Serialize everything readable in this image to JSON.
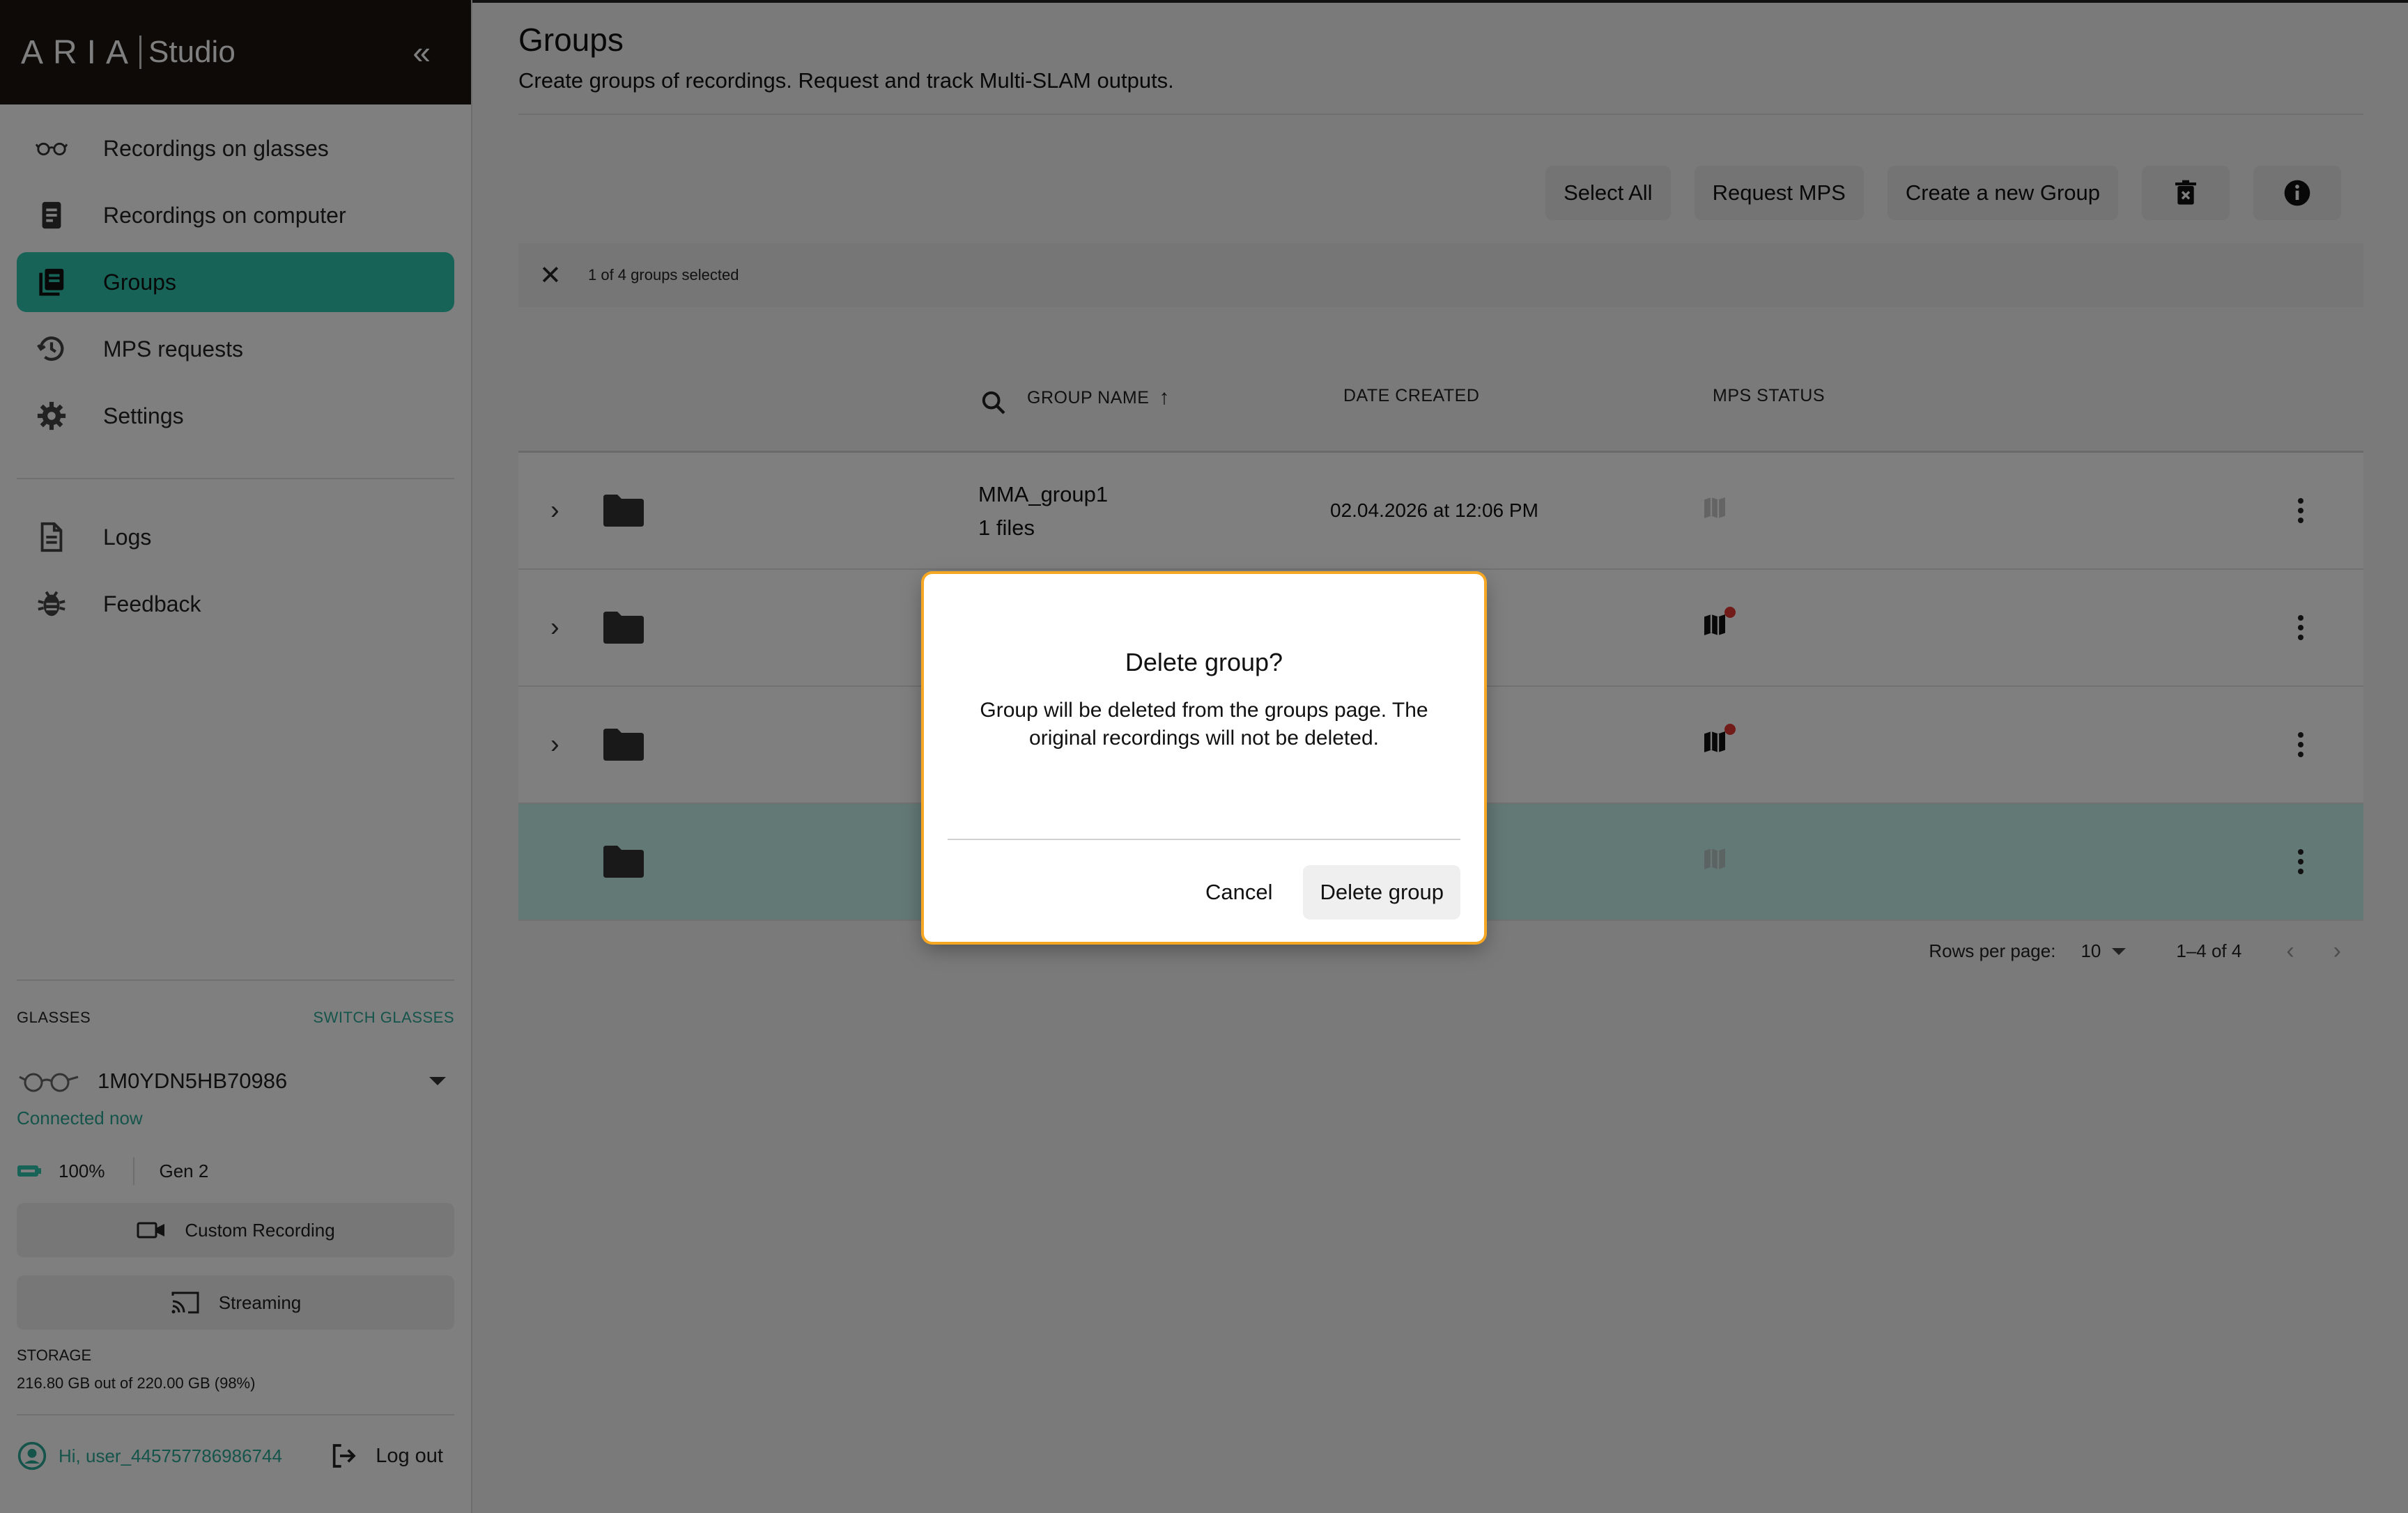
{
  "app": {
    "brand_word": "ARIA",
    "brand_product": "Studio"
  },
  "sidebar": {
    "items": [
      {
        "label": "Recordings on glasses",
        "icon": "glasses-icon"
      },
      {
        "label": "Recordings on computer",
        "icon": "document-icon"
      },
      {
        "label": "Groups",
        "icon": "groups-icon",
        "active": true
      },
      {
        "label": "MPS requests",
        "icon": "history-icon"
      },
      {
        "label": "Settings",
        "icon": "gear-icon"
      }
    ],
    "secondary_items": [
      {
        "label": "Logs",
        "icon": "logs-icon"
      },
      {
        "label": "Feedback",
        "icon": "bug-icon"
      }
    ],
    "glasses": {
      "section_label": "GLASSES",
      "switch_label": "SWITCH GLASSES",
      "device_id": "1M0YDN5HB70986",
      "connection": "Connected now",
      "battery": "100%",
      "generation": "Gen 2",
      "custom_recording_label": "Custom Recording",
      "streaming_label": "Streaming",
      "storage_label": "STORAGE",
      "storage_value": "216.80 GB out of 220.00 GB (98%)"
    },
    "user": {
      "greeting": "Hi, user_445757786986744",
      "logout_label": "Log out"
    }
  },
  "main": {
    "title": "Groups",
    "subtitle": "Create groups of recordings. Request and track Multi-SLAM outputs.",
    "toolbar": {
      "select_all": "Select All",
      "request_mps": "Request MPS",
      "create_group": "Create a new Group"
    },
    "selection_text": "1 of 4 groups selected",
    "table": {
      "columns": {
        "name": "GROUP NAME",
        "date": "DATE CREATED",
        "mps": "MPS STATUS"
      },
      "rows": [
        {
          "name": "MMA_group1",
          "files": "1 files",
          "date": "02.04.2026 at 12:06 PM",
          "mps_alert": false,
          "selected": false,
          "expandable": true
        },
        {
          "name": "",
          "files": "",
          "date": "PM",
          "mps_alert": true,
          "selected": false,
          "expandable": true
        },
        {
          "name": "",
          "files": "",
          "date": "PM",
          "mps_alert": true,
          "selected": false,
          "expandable": true
        },
        {
          "name": "",
          "files": "",
          "date": "PM",
          "mps_alert": false,
          "selected": true,
          "expandable": false
        }
      ]
    },
    "pagination": {
      "rows_per_page_label": "Rows per page:",
      "rows_per_page_value": "10",
      "range": "1–4 of 4"
    }
  },
  "dialog": {
    "title": "Delete group?",
    "body": "Group will be deleted from the groups page. The original recordings will not be deleted.",
    "cancel_label": "Cancel",
    "confirm_label": "Delete group"
  },
  "colors": {
    "accent": "#2fc7b1",
    "accent_text": "#2aa896",
    "brand_bg": "#1a1410",
    "alert": "#e53935",
    "dialog_focus": "#f5a623"
  }
}
